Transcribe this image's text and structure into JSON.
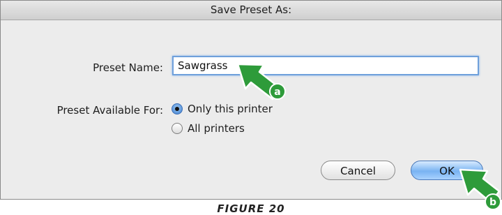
{
  "dialog": {
    "title": "Save Preset As:",
    "preset_name_label": "Preset Name:",
    "preset_name_value": "Sawgrass",
    "available_for_label": "Preset Available For:",
    "radio_options": [
      {
        "label": "Only this printer",
        "selected": true
      },
      {
        "label": "All printers",
        "selected": false
      }
    ],
    "cancel_label": "Cancel",
    "ok_label": "OK"
  },
  "callouts": [
    {
      "letter": "a",
      "color": "#2e9b3a"
    },
    {
      "letter": "b",
      "color": "#2e9b3a"
    }
  ],
  "caption": "FIGURE 20"
}
